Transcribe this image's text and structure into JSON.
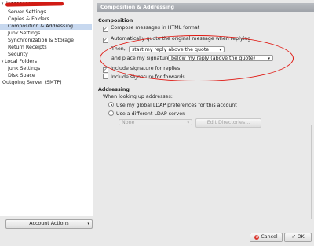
{
  "sidebar": {
    "account_name": "j••••••••••n",
    "items": [
      {
        "label": "Server Settings",
        "indent": 1
      },
      {
        "label": "Copies & Folders",
        "indent": 1
      },
      {
        "label": "Composition & Addressing",
        "indent": 1,
        "selected": true
      },
      {
        "label": "Junk Settings",
        "indent": 1
      },
      {
        "label": "Synchronization & Storage",
        "indent": 1
      },
      {
        "label": "Return Receipts",
        "indent": 1
      },
      {
        "label": "Security",
        "indent": 1
      },
      {
        "label": "Local Folders",
        "indent": 0,
        "expander": "▾"
      },
      {
        "label": "Junk Settings",
        "indent": 1
      },
      {
        "label": "Disk Space",
        "indent": 1
      },
      {
        "label": "Outgoing Server (SMTP)",
        "indent": 0
      }
    ],
    "account_actions": "Account Actions"
  },
  "header": {
    "title": "Composition & Addressing"
  },
  "composition": {
    "section_title": "Composition",
    "html_format_label": "Compose messages in HTML format",
    "html_format_checked": true,
    "auto_quote_label": "Automatically quote the original message when replying",
    "auto_quote_checked": true,
    "then_label": "Then,",
    "then_value": "start my reply above the quote",
    "signature_label": "and place my signature",
    "signature_value": "below my reply (above the quote)",
    "include_replies_label": "Include signature for replies",
    "include_replies_checked": true,
    "include_forwards_label": "Include signature for forwards",
    "include_forwards_checked": false
  },
  "addressing": {
    "section_title": "Addressing",
    "lookup_label": "When looking up addresses:",
    "global_ldap_label": "Use my global LDAP preferences for this account",
    "different_ldap_label": "Use a different LDAP server:",
    "ldap_select_value": "None",
    "edit_directories_label": "Edit Directories..."
  },
  "footer": {
    "cancel_label": "Cancel",
    "ok_label": "OK"
  },
  "colors": {
    "annotation": "#e01a14",
    "selected_row": "#c7d8ef",
    "cancel_icon": "#d9332a",
    "ok_icon": "#3a3a3a"
  }
}
